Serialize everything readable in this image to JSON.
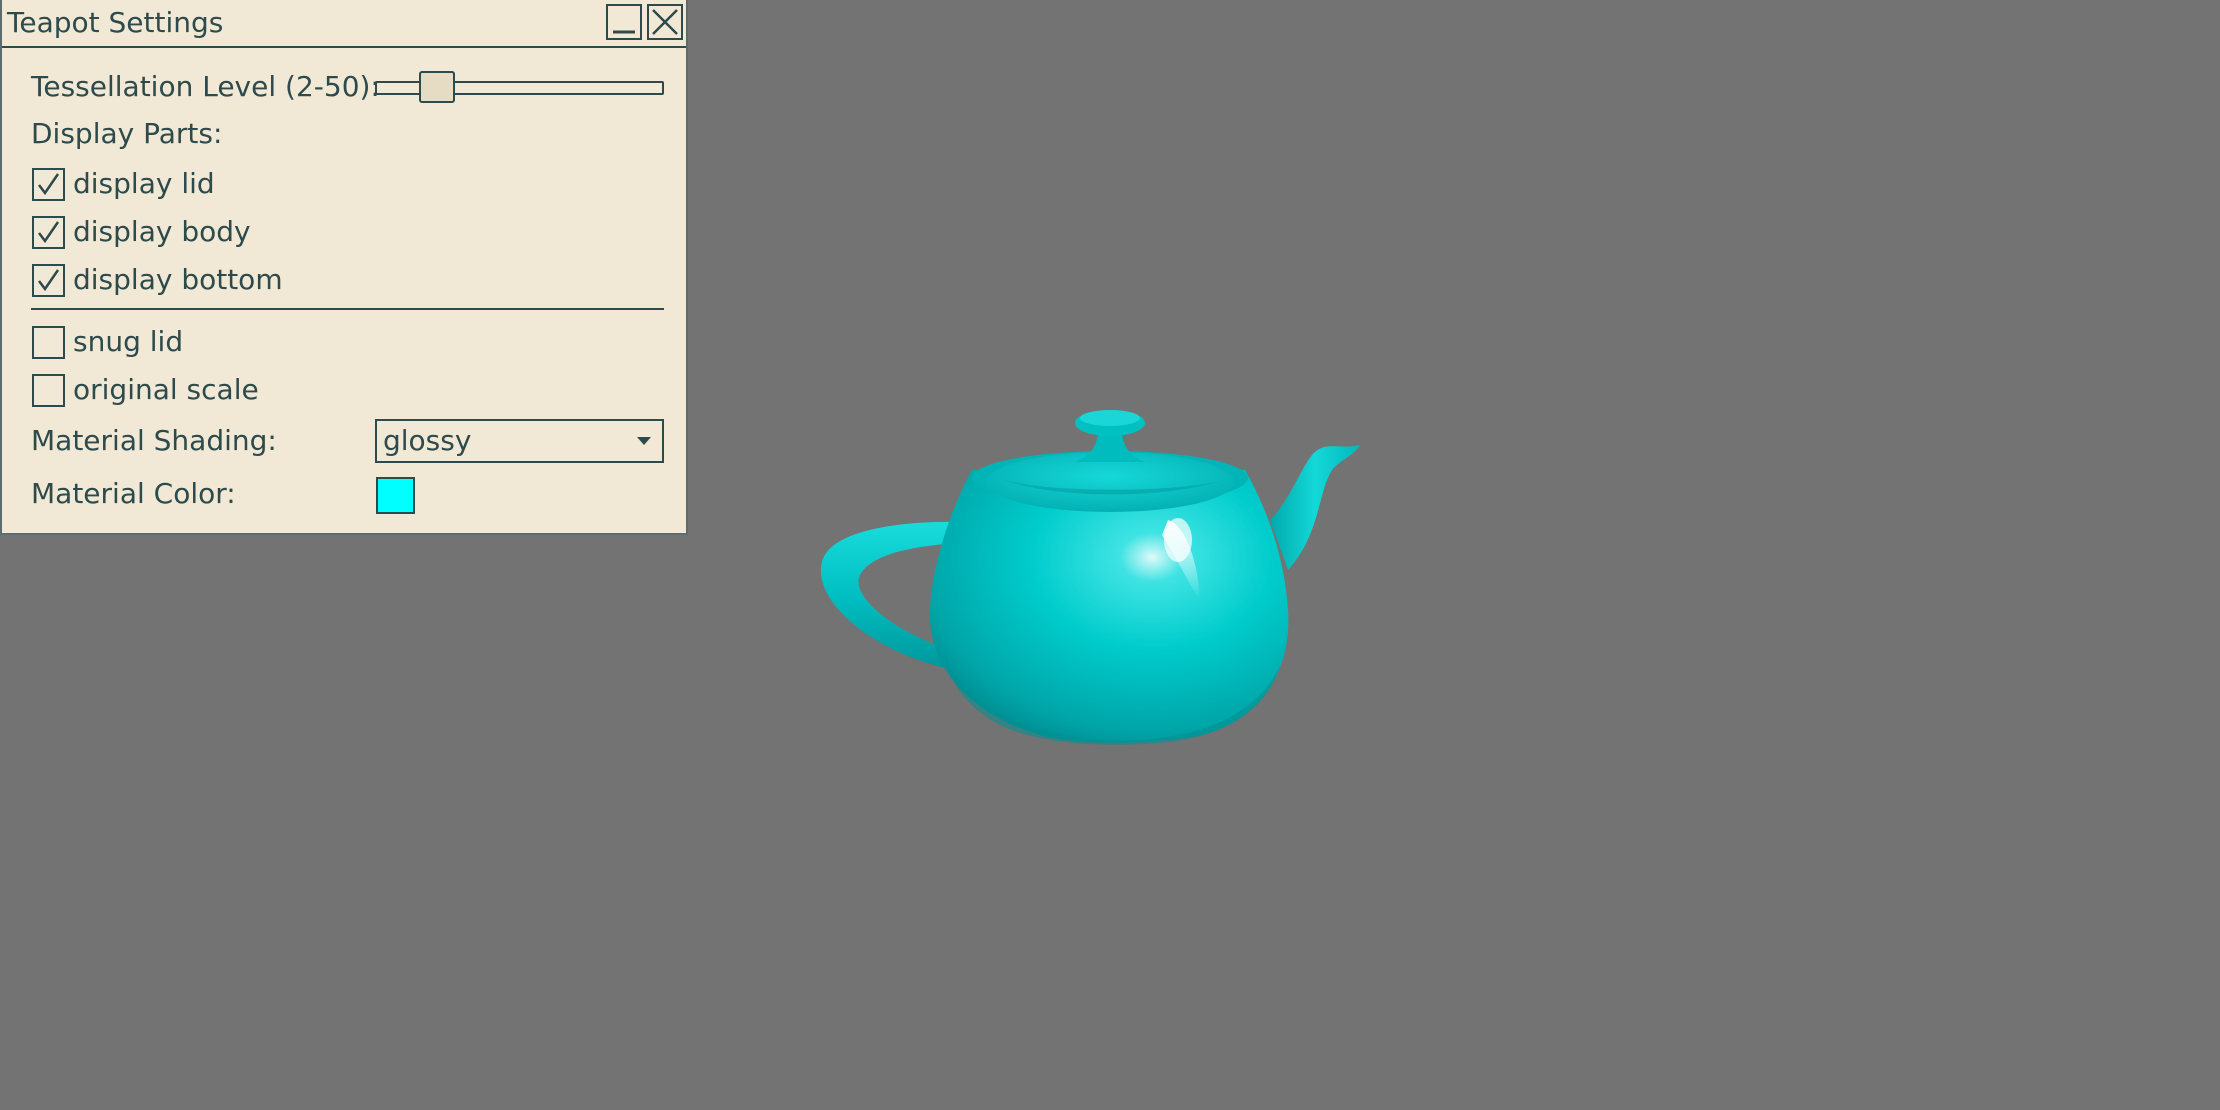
{
  "window": {
    "title": "Teapot Settings",
    "minimize_icon": "minimize-icon",
    "close_icon": "close-icon"
  },
  "tessellation": {
    "label": "Tessellation Level (2-50):",
    "min": 2,
    "max": 50,
    "value": 10
  },
  "display_parts": {
    "heading": "Display Parts:",
    "items": [
      {
        "label": "display lid",
        "checked": true
      },
      {
        "label": "display body",
        "checked": true
      },
      {
        "label": "display bottom",
        "checked": true
      }
    ]
  },
  "options": {
    "items": [
      {
        "label": "snug lid",
        "checked": false
      },
      {
        "label": "original scale",
        "checked": false
      }
    ]
  },
  "material_shading": {
    "label": "Material Shading:",
    "selected": "glossy"
  },
  "material_color": {
    "label": "Material Color:",
    "value": "#00ffff"
  },
  "colors": {
    "viewport_background": "#737373",
    "teapot": "#00c8c8",
    "panel_background": "#f1e9d5",
    "panel_text": "#2d4a4c"
  }
}
